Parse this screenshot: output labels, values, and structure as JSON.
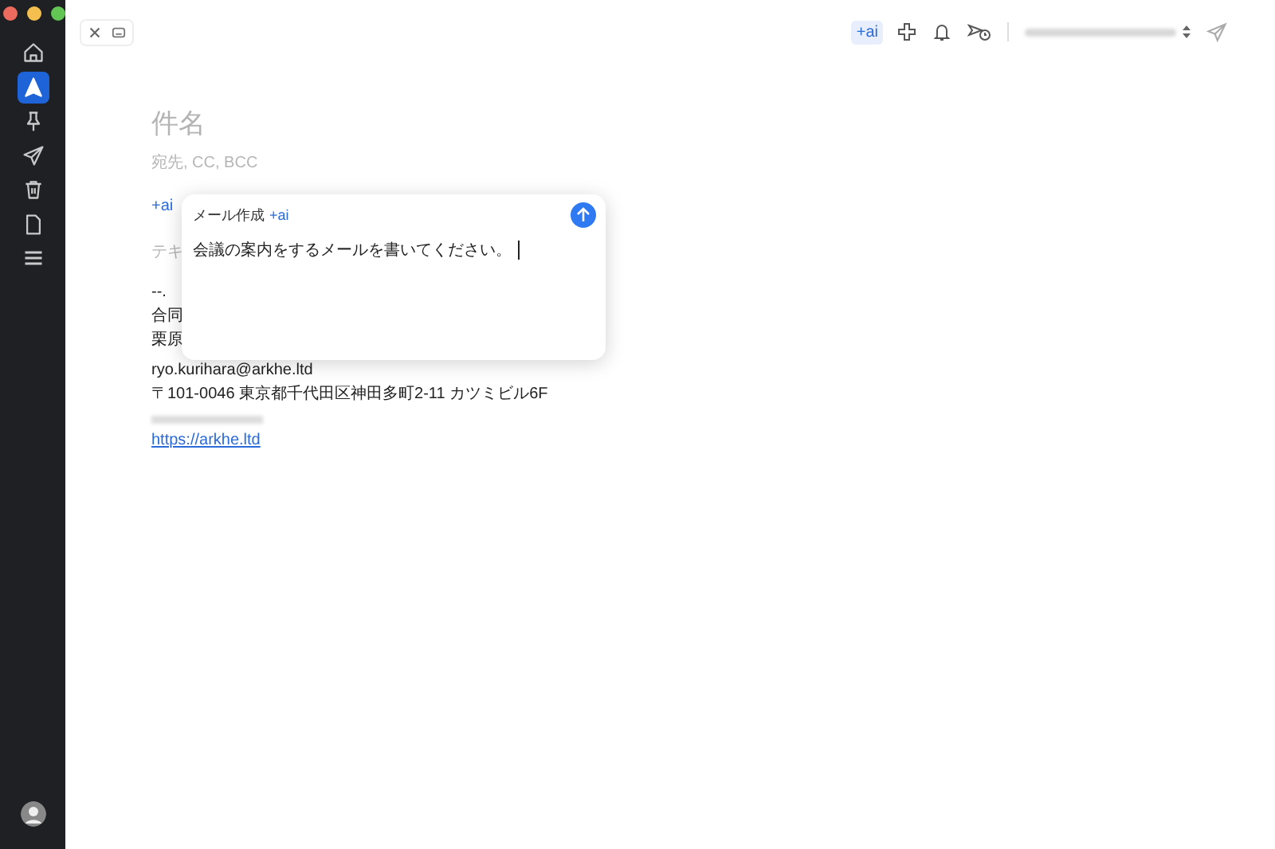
{
  "toolbar": {
    "ai_button": "+ai"
  },
  "compose": {
    "subject_placeholder": "件名",
    "recipients_placeholder": "宛先, CC, BCC",
    "ai_label": "+ai",
    "body_placeholder": "テキ",
    "signature": [
      "--.",
      "合同",
      "栗原",
      "ryo.kurihara@arkhe.ltd",
      "〒101-0046 東京都千代田区神田多町2-11 カツミビル6F"
    ],
    "link": "https://arkhe.ltd"
  },
  "ai_popup": {
    "title": "メール作成",
    "badge": "+ai",
    "prompt": "会議の案内をするメールを書いてください。"
  },
  "sidebar": {
    "items": [
      {
        "kind": "home",
        "selected": false
      },
      {
        "kind": "compose",
        "selected": true
      },
      {
        "kind": "pin",
        "selected": false
      },
      {
        "kind": "send",
        "selected": false
      },
      {
        "kind": "trash",
        "selected": false
      },
      {
        "kind": "file",
        "selected": false
      },
      {
        "kind": "menu",
        "selected": false
      }
    ]
  }
}
